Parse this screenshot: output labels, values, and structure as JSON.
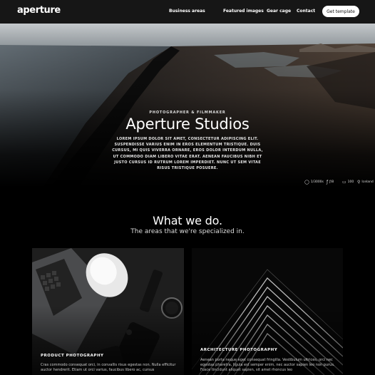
{
  "nav": {
    "logo": "aperture",
    "links": [
      {
        "label": "Business areas"
      },
      {
        "label": "Featured images"
      },
      {
        "label": "Gear cage"
      },
      {
        "label": "Contact"
      }
    ],
    "cta": "Get template"
  },
  "hero": {
    "eyebrow": "PHOTOGRAPHER & FILMMAKER",
    "title": "Aperture Studios",
    "body": "LOREM IPSUM DOLOR SIT AMET, CONSECTETUR ADIPISCING ELIT. SUSPENDISSE VARIUS ENIM IN EROS ELEMENTUM TRISTIQUE. DUIS CURSUS, MI QUIS VIVERRA ORNARE, EROS DOLOR INTERDUM NULLA, UT COMMODO DIAM LIBERO VITAE ERAT. AENEAN FAUCIBUS NIBH ET JUSTO CURSUS ID RUTRUM LOREM IMPERDIET. NUNC UT SEM VITAE RISUS TRISTIQUE POSUERE.",
    "meta": [
      {
        "icon": "aperture-icon",
        "glyph": "◯",
        "text": "1/3000s"
      },
      {
        "icon": "lens-icon",
        "glyph": "ƒ",
        "text": "ƒ/8"
      },
      {
        "icon": "iso-icon",
        "glyph": "▭",
        "text": "100"
      },
      {
        "icon": "location-pin-icon",
        "glyph": "⚲",
        "text": "Iceland"
      }
    ]
  },
  "section": {
    "title": "What we do.",
    "subtitle": "The areas that we're specialized in."
  },
  "cards": [
    {
      "title": "PRODUCT PHOTOGRAPHY",
      "text": "Cras commodo consequat orci, in convallis risus egestas non. Nulla efficitur auctor hendrerit. Etiam ut orci varius, faucibus libero ac, cursus"
    },
    {
      "title": "ARCHITECTURE PHOTOGRAPHY",
      "text": "Aenean porta neque eget consequat fringilla. Vestibulum ultrices, orci nec egestas pharetra, ligula est semper enim, nec auctor sapien leo non purus. Fusce tincidunt aliquet sapien, sit amet rhoncus leo"
    }
  ],
  "colors": {
    "nav_bg": "#161616",
    "page_bg": "#000000",
    "cta_bg": "#ffffff",
    "text": "#ffffff"
  }
}
